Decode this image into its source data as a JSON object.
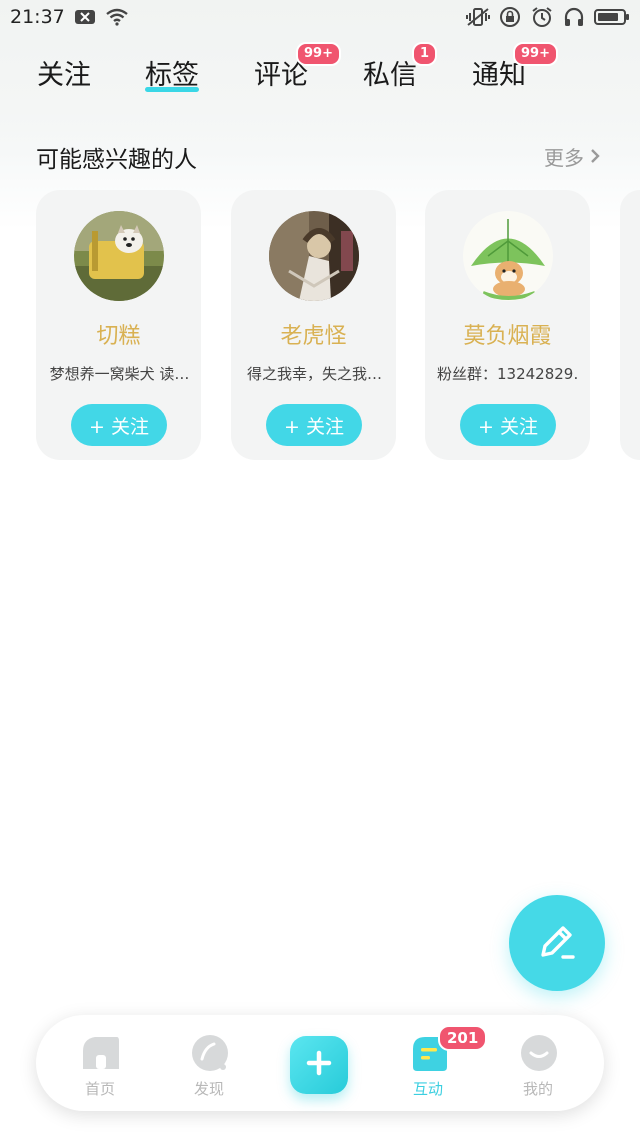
{
  "status_bar": {
    "time": "21:37",
    "left_icons": [
      "notification-x-icon",
      "wifi-icon"
    ],
    "right_icons": [
      "vibrate-icon",
      "lock-rotation-icon",
      "alarm-icon",
      "headphones-icon",
      "battery-icon"
    ]
  },
  "tabs": [
    {
      "label": "关注",
      "badge": ""
    },
    {
      "label": "标签",
      "badge": "",
      "active": true
    },
    {
      "label": "评论",
      "badge": "99+"
    },
    {
      "label": "私信",
      "badge": "1"
    },
    {
      "label": "通知",
      "badge": "99+"
    }
  ],
  "section": {
    "title": "可能感兴趣的人",
    "more_label": "更多"
  },
  "cards": [
    {
      "name": "切糕",
      "bio": "梦想养一窝柴犬 读…",
      "follow_label": "+ 关注"
    },
    {
      "name": "老虎怪",
      "bio": "得之我幸，失之我…",
      "follow_label": "+ 关注"
    },
    {
      "name": "莫负烟霞",
      "bio": "粉丝群：13242829…",
      "follow_label": "+ 关注"
    }
  ],
  "bottom_nav": {
    "items": [
      {
        "label": "首页",
        "icon": "home-icon"
      },
      {
        "label": "发现",
        "icon": "discover-icon"
      },
      {
        "label": "",
        "icon": "plus-icon"
      },
      {
        "label": "互动",
        "icon": "interaction-icon",
        "active": true,
        "badge": "201"
      },
      {
        "label": "我的",
        "icon": "profile-icon"
      }
    ]
  },
  "colors": {
    "accent": "#42d7e7",
    "badge": "#f0556f",
    "name_gold": "#d9b152"
  }
}
